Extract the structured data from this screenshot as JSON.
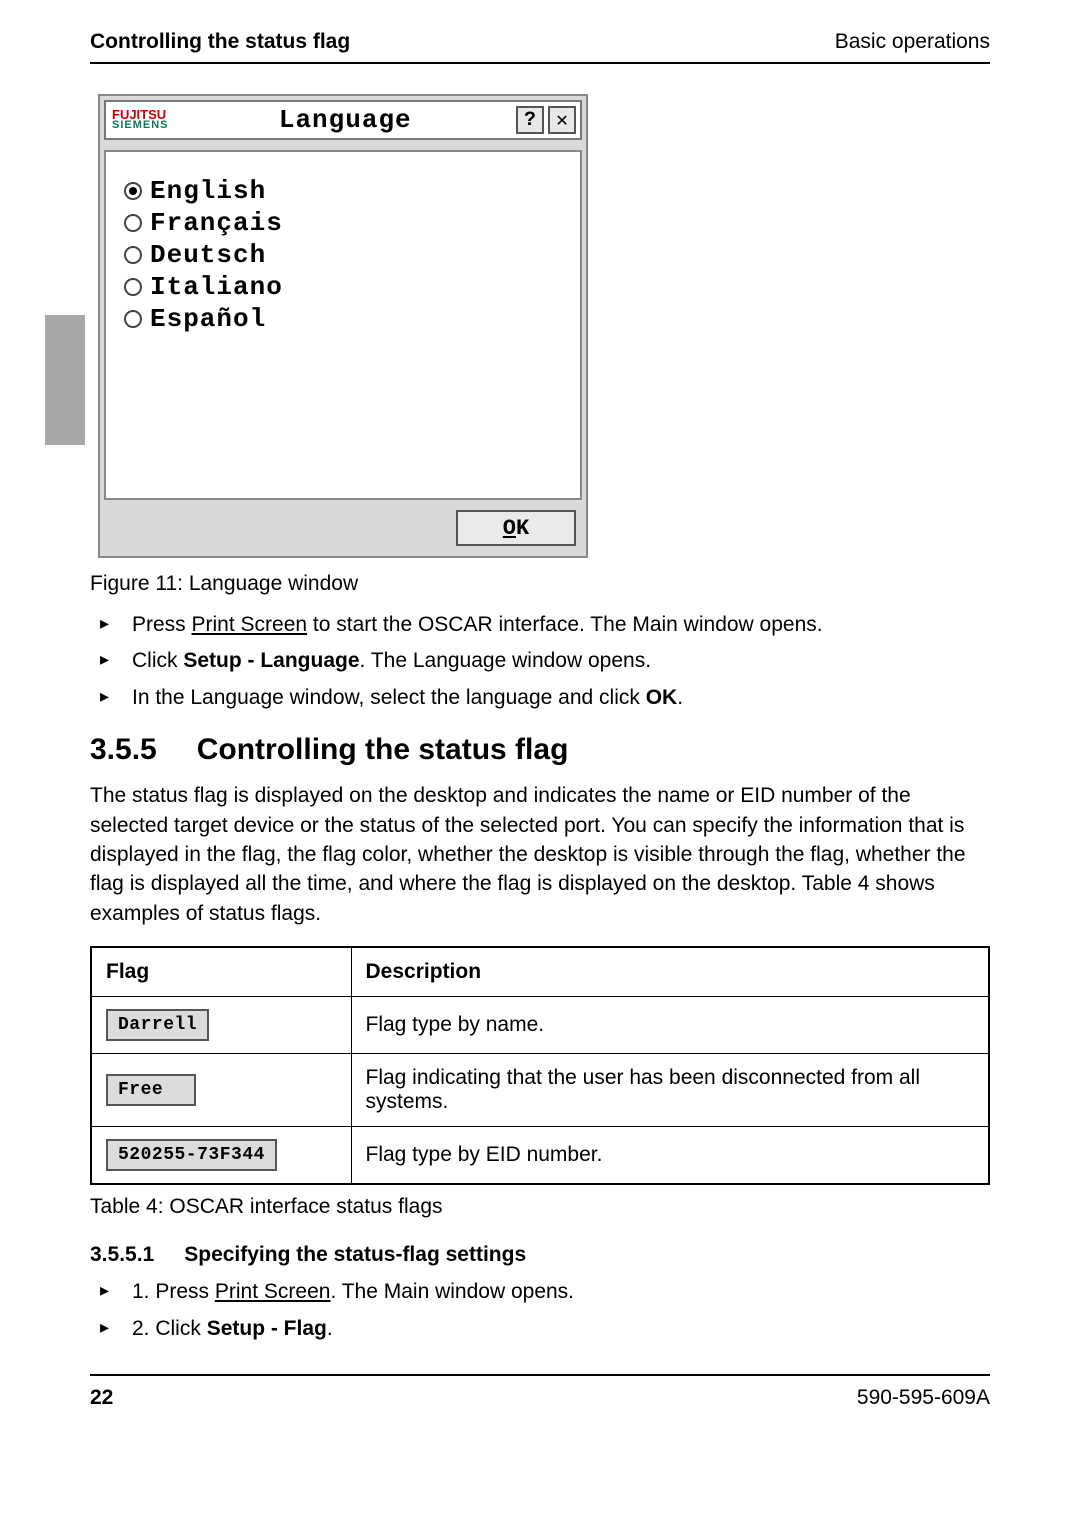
{
  "header": {
    "left": "Controlling the status flag",
    "right": "Basic operations"
  },
  "dialog": {
    "logo_top": "FUJITSU",
    "logo_bot": "SIEMENS",
    "title": "Language",
    "help_label": "?",
    "close_label": "✕",
    "options": [
      {
        "label": "English",
        "selected": true
      },
      {
        "label": "Français",
        "selected": false
      },
      {
        "label": "Deutsch",
        "selected": false
      },
      {
        "label": "Italiano",
        "selected": false
      },
      {
        "label": "Español",
        "selected": false
      }
    ],
    "ok_underline": "O",
    "ok_rest": "K"
  },
  "fig_caption": "Figure 11: Language window",
  "steps_a": {
    "s0_a": "Press ",
    "s0_u": "Print Screen",
    "s0_b": " to start the OSCAR interface. The Main window opens.",
    "s1_a": "Click ",
    "s1_bold": "Setup - Language",
    "s1_b": ". The Language window opens.",
    "s2_a": "In the Language window, select the language and click ",
    "s2_bold": "OK",
    "s2_b": "."
  },
  "section": {
    "num": "3.5.5",
    "title": "Controlling the status flag",
    "para": "The status flag is displayed on the desktop and indicates the name or EID number of the selected target device or the status of the selected port. You can specify the information that is displayed in the flag, the flag color, whether the desktop is visible through the flag, whether the flag is displayed all the time, and where the flag is displayed on the desktop. Table 4 shows examples of status flags."
  },
  "table": {
    "h1": "Flag",
    "h2": "Description",
    "rows": [
      {
        "flag": "Darrell",
        "desc": "Flag type by name."
      },
      {
        "flag": "Free",
        "desc": "Flag indicating that the user has been disconnected from all systems."
      },
      {
        "flag": "520255-73F344",
        "desc": "Flag type by EID number."
      }
    ]
  },
  "table_caption": "Table 4: OSCAR interface status flags",
  "subsection": {
    "num": "3.5.5.1",
    "title": "Specifying the status-flag settings"
  },
  "steps_b": {
    "s0_a": "1. Press ",
    "s0_u": "Print Screen",
    "s0_b": ". The Main window opens.",
    "s1_a": "2. Click ",
    "s1_bold": "Setup - Flag",
    "s1_b": "."
  },
  "footer": {
    "page": "22",
    "doc": "590-595-609A"
  }
}
